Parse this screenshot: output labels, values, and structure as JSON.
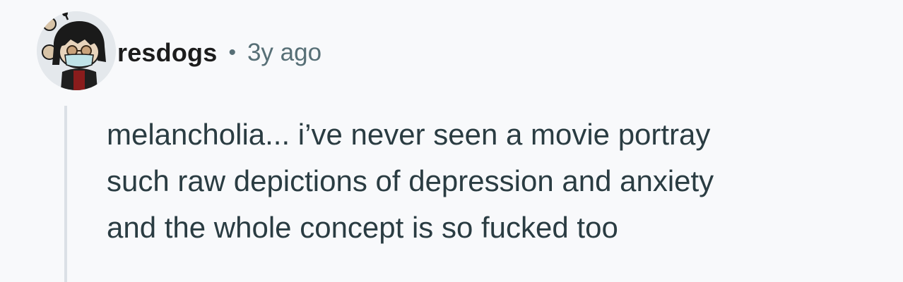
{
  "comment": {
    "author": "resdogs",
    "separator": "•",
    "timestamp": "3y ago",
    "avatar_icon": "snoo-avatar-icon",
    "body_lines": [
      "melancholia... i’ve never seen a movie portray",
      "such raw depictions of depression and anxiety",
      "and the whole concept is so fucked too"
    ]
  },
  "colors": {
    "background": "#f8f9fb",
    "text": "#2a3c42",
    "meta": "#576f76",
    "thread_line": "#dbe0e6"
  }
}
